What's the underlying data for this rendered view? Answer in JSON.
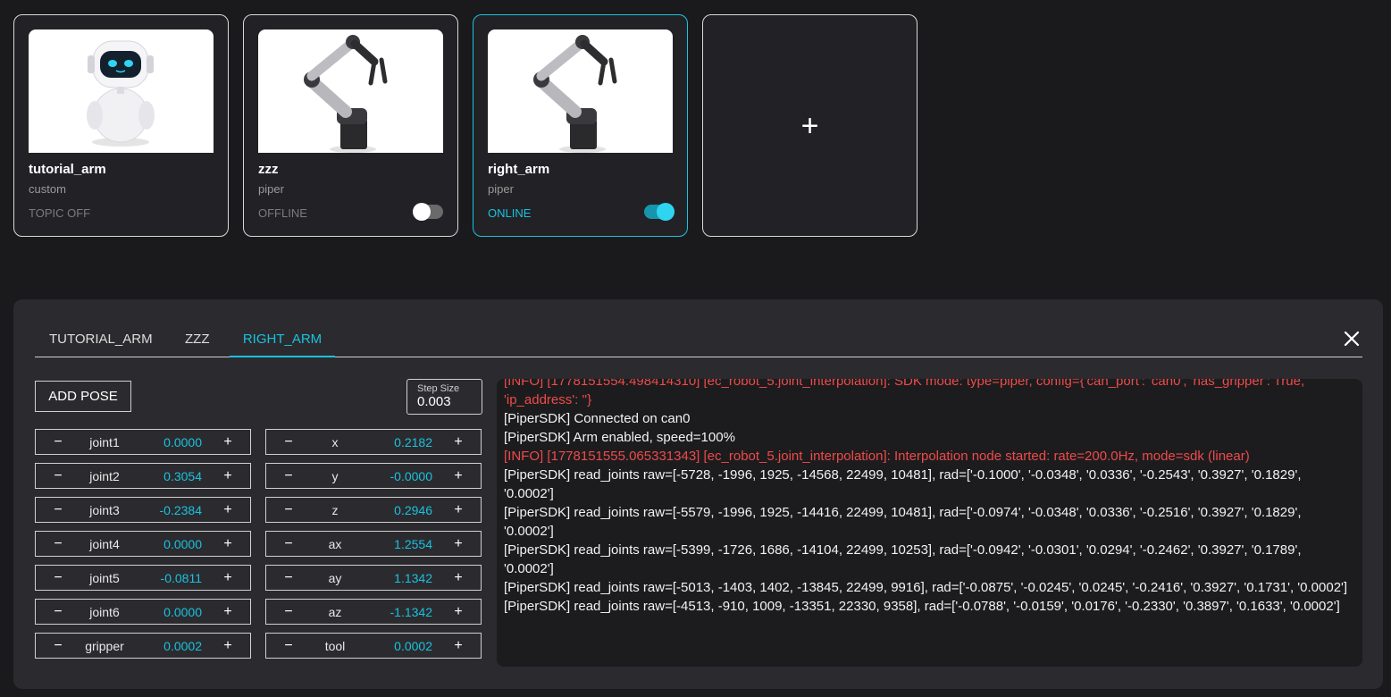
{
  "cards": [
    {
      "name": "tutorial_arm",
      "type": "custom",
      "status": "TOPIC OFF",
      "toggle": null,
      "image": "robot-mascot"
    },
    {
      "name": "zzz",
      "type": "piper",
      "status": "OFFLINE",
      "toggle": "off",
      "image": "robot-arm"
    },
    {
      "name": "right_arm",
      "type": "piper",
      "status": "ONLINE",
      "toggle": "on",
      "image": "robot-arm"
    }
  ],
  "add_card": {
    "icon": "plus-icon",
    "label": "+"
  },
  "tabs": [
    "TUTORIAL_ARM",
    "ZZZ",
    "RIGHT_ARM"
  ],
  "active_tab": "RIGHT_ARM",
  "controls": {
    "add_pose": "ADD POSE",
    "step_size_label": "Step Size",
    "step_size_value": "0.003"
  },
  "joints": [
    {
      "label": "joint1",
      "value": "0.0000"
    },
    {
      "label": "joint2",
      "value": "0.3054"
    },
    {
      "label": "joint3",
      "value": "-0.2384"
    },
    {
      "label": "joint4",
      "value": "0.0000"
    },
    {
      "label": "joint5",
      "value": "-0.0811"
    },
    {
      "label": "joint6",
      "value": "0.0000"
    },
    {
      "label": "gripper",
      "value": "0.0002"
    }
  ],
  "cartesian": [
    {
      "label": "x",
      "value": "0.2182"
    },
    {
      "label": "y",
      "value": "-0.0000"
    },
    {
      "label": "z",
      "value": "0.2946"
    },
    {
      "label": "ax",
      "value": "1.2554"
    },
    {
      "label": "ay",
      "value": "1.1342"
    },
    {
      "label": "az",
      "value": "-1.1342"
    },
    {
      "label": "tool",
      "value": "0.0002"
    }
  ],
  "stepper": {
    "minus": "−",
    "plus": "+"
  },
  "log": [
    {
      "level": "info",
      "text": "[INFO] [1778151554.498414310] [ec_robot_5.joint_interpolation]: SDK mode: type=piper, config={'can_port': 'can0', 'has_gripper': True, 'ip_address': ''}"
    },
    {
      "level": "plain",
      "text": "[PiperSDK] Connected on can0"
    },
    {
      "level": "plain",
      "text": "[PiperSDK] Arm enabled, speed=100%"
    },
    {
      "level": "info",
      "text": "[INFO] [1778151555.065331343] [ec_robot_5.joint_interpolation]: Interpolation node started: rate=200.0Hz, mode=sdk (linear)"
    },
    {
      "level": "plain",
      "text": "[PiperSDK] read_joints raw=[-5728, -1996, 1925, -14568, 22499, 10481], rad=['-0.1000', '-0.0348', '0.0336', '-0.2543', '0.3927', '0.1829', '0.0002']"
    },
    {
      "level": "plain",
      "text": "[PiperSDK] read_joints raw=[-5579, -1996, 1925, -14416, 22499, 10481], rad=['-0.0974', '-0.0348', '0.0336', '-0.2516', '0.3927', '0.1829', '0.0002']"
    },
    {
      "level": "plain",
      "text": "[PiperSDK] read_joints raw=[-5399, -1726, 1686, -14104, 22499, 10253], rad=['-0.0942', '-0.0301', '0.0294', '-0.2462', '0.3927', '0.1789', '0.0002']"
    },
    {
      "level": "plain",
      "text": "[PiperSDK] read_joints raw=[-5013, -1403, 1402, -13845, 22499, 9916], rad=['-0.0875', '-0.0245', '0.0245', '-0.2416', '0.3927', '0.1731', '0.0002']"
    },
    {
      "level": "plain",
      "text": "[PiperSDK] read_joints raw=[-4513, -910, 1009, -13351, 22330, 9358], rad=['-0.0788', '-0.0159', '0.0176', '-0.2330', '0.3897', '0.1633', '0.0002']"
    }
  ],
  "colors": {
    "accent": "#19c2de",
    "info_log": "#ef4a4a",
    "panel": "#2b2b2f",
    "background": "#1a1a1c"
  }
}
